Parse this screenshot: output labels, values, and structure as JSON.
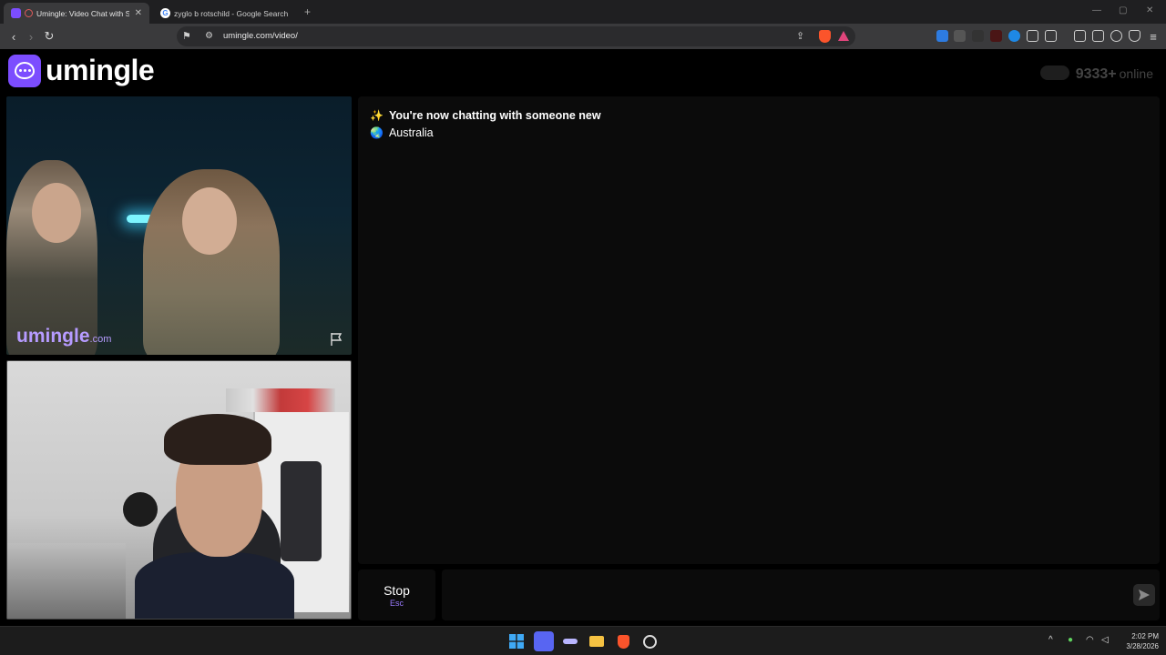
{
  "browser": {
    "tabs": [
      {
        "title": "Umingle: Video Chat with Str",
        "active": true
      },
      {
        "title": "zyglo b rotschild - Google Search",
        "active": false
      }
    ],
    "url": "umingle.com/video/",
    "window_controls": {
      "minimize": "—",
      "maximize": "▢",
      "close": "✕"
    }
  },
  "site": {
    "logo_text": "umingle",
    "online_count": "9333+",
    "online_label": "online"
  },
  "stranger_video": {
    "watermark_main": "umingle",
    "watermark_suffix": ".com"
  },
  "chat": {
    "messages": [
      {
        "emoji": "✨",
        "text": "You're now chatting with someone new",
        "bold": true
      },
      {
        "emoji": "🌏",
        "text": "Australia",
        "bold": false
      }
    ],
    "input_placeholder": ""
  },
  "controls": {
    "stop_label": "Stop",
    "stop_shortcut": "Esc"
  },
  "taskbar": {
    "time": "2:02 PM",
    "date": "3/28/2026"
  },
  "colors": {
    "brand": "#7c4dff",
    "watermark": "#b69bff",
    "background": "#000000",
    "panel": "#0b0b0b"
  }
}
